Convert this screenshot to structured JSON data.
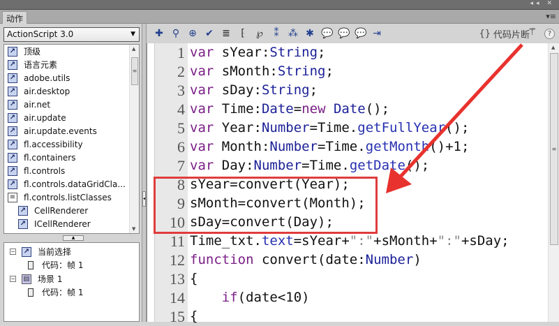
{
  "panel": {
    "tab": "动作",
    "collapse_icon": "◂◂",
    "close_icon": "✕",
    "menu_icon": "▾≡"
  },
  "left": {
    "version": "ActionScript 3.0",
    "items": [
      {
        "label": "顶级",
        "icon": "class-icon",
        "sub": false
      },
      {
        "label": "语言元素",
        "icon": "class-icon",
        "sub": false
      },
      {
        "label": "adobe.utils",
        "icon": "class-icon",
        "sub": false
      },
      {
        "label": "air.desktop",
        "icon": "class-icon",
        "sub": false
      },
      {
        "label": "air.net",
        "icon": "class-icon",
        "sub": false
      },
      {
        "label": "air.update",
        "icon": "class-icon",
        "sub": false
      },
      {
        "label": "air.update.events",
        "icon": "class-icon",
        "sub": false
      },
      {
        "label": "fl.accessibility",
        "icon": "class-icon",
        "sub": false
      },
      {
        "label": "fl.containers",
        "icon": "class-icon",
        "sub": false
      },
      {
        "label": "fl.controls",
        "icon": "class-icon",
        "sub": false
      },
      {
        "label": "fl.controls.dataGridCla...",
        "icon": "class-icon",
        "sub": false
      },
      {
        "label": "fl.controls.listClasses",
        "icon": "book-icon",
        "sub": true
      },
      {
        "label": "CellRenderer",
        "icon": "class-icon",
        "sub": true
      },
      {
        "label": "ICellRenderer",
        "icon": "class-icon",
        "sub": true
      }
    ],
    "tree": {
      "current": "当前选择",
      "current_frame": "代码：帧 1",
      "scene": "场景 1",
      "scene_frame": "代码：帧 1"
    }
  },
  "toolbar": {
    "snippets": "代码片断",
    "help": "?"
  },
  "code": [
    [
      [
        "var",
        "kw"
      ],
      [
        " sYear:",
        ""
      ],
      [
        "String",
        "ty"
      ],
      [
        ";",
        ""
      ]
    ],
    [
      [
        "var",
        "kw"
      ],
      [
        " sMonth:",
        ""
      ],
      [
        "String",
        "ty"
      ],
      [
        ";",
        ""
      ]
    ],
    [
      [
        "var",
        "kw"
      ],
      [
        " sDay:",
        ""
      ],
      [
        "String",
        "ty"
      ],
      [
        ";",
        ""
      ]
    ],
    [
      [
        "var",
        "kw"
      ],
      [
        " Time:",
        ""
      ],
      [
        "Date",
        "ty"
      ],
      [
        "=",
        ""
      ],
      [
        "new",
        "kw"
      ],
      [
        " ",
        ""
      ],
      [
        "Date",
        "ty"
      ],
      [
        "();",
        ""
      ]
    ],
    [
      [
        "var",
        "kw"
      ],
      [
        " Year:",
        ""
      ],
      [
        "Number",
        "ty"
      ],
      [
        "=Time.",
        ""
      ],
      [
        "getFullYear",
        "fn"
      ],
      [
        "();",
        ""
      ]
    ],
    [
      [
        "var",
        "kw"
      ],
      [
        " Month:",
        ""
      ],
      [
        "Number",
        "ty"
      ],
      [
        "=Time.",
        ""
      ],
      [
        "getMonth",
        "fn"
      ],
      [
        "()+1;",
        ""
      ]
    ],
    [
      [
        "var",
        "kw"
      ],
      [
        " Day:",
        ""
      ],
      [
        "Number",
        "ty"
      ],
      [
        "=Time.",
        ""
      ],
      [
        "getDate",
        "fn"
      ],
      [
        "();",
        ""
      ]
    ],
    [
      [
        "sYear=convert(Year);",
        ""
      ]
    ],
    [
      [
        "sMonth=convert(Month);",
        ""
      ]
    ],
    [
      [
        "sDay=convert(Day);",
        ""
      ]
    ],
    [
      [
        "Time_txt.",
        ""
      ],
      [
        "text",
        "fn"
      ],
      [
        "=sYear+",
        ""
      ],
      [
        "\":\"",
        "st"
      ],
      [
        "+sMonth+",
        ""
      ],
      [
        "\":\"",
        "st"
      ],
      [
        "+sDay;",
        ""
      ]
    ],
    [
      [
        "function",
        "kw"
      ],
      [
        " convert(date:",
        ""
      ],
      [
        "Number",
        "ty"
      ],
      [
        ")",
        ""
      ]
    ],
    [
      [
        "{",
        ""
      ]
    ],
    [
      [
        "    ",
        ""
      ],
      [
        "if",
        "kw"
      ],
      [
        "(date<10)",
        ""
      ]
    ],
    [
      [
        "{",
        ""
      ]
    ]
  ],
  "colors": {
    "highlight_box": "#e03c3c",
    "arrow": "#e8322e"
  }
}
